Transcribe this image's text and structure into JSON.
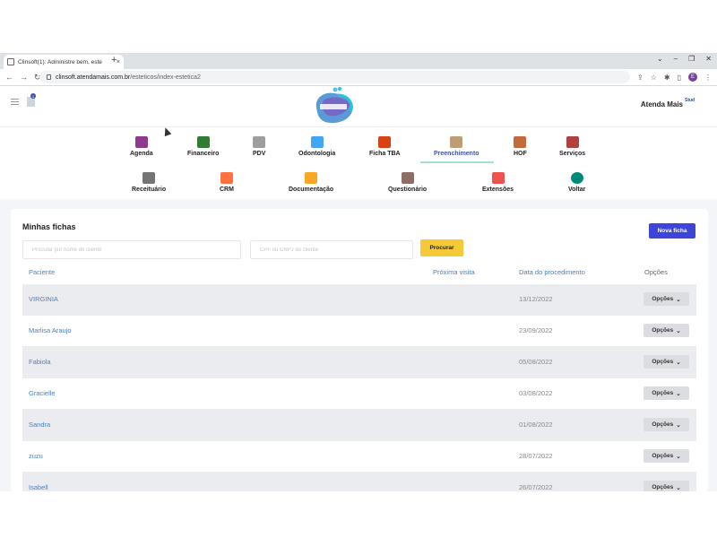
{
  "browser": {
    "tab_title": "Clinsoft(1): Administre bem, este",
    "tab_close": "×",
    "new_tab": "+",
    "url_host": "clinsoft.atendamais.com.br",
    "url_path": "/esteticos/index-estetica2",
    "profile_initial": "E"
  },
  "header": {
    "notification_count": "1",
    "user_name": "Atenda Mais",
    "user_badge": "Stud"
  },
  "modules_row1": [
    {
      "label": "Agenda",
      "color": "#8e3a8e"
    },
    {
      "label": "Financeiro",
      "color": "#2e7d32"
    },
    {
      "label": "PDV",
      "color": "#9e9e9e"
    },
    {
      "label": "Odontologia",
      "color": "#42a5f5"
    },
    {
      "label": "Ficha TBA",
      "color": "#d84315"
    },
    {
      "label": "Preenchimento",
      "color": "#bf9d74"
    },
    {
      "label": "HOF",
      "color": "#c46a3a"
    },
    {
      "label": "Serviços",
      "color": "#b0413e"
    }
  ],
  "modules_row2": [
    {
      "label": "Receituário",
      "color": "#757575"
    },
    {
      "label": "CRM",
      "color": "#ff7043"
    },
    {
      "label": "Documentação",
      "color": "#f9a825"
    },
    {
      "label": "Questionário",
      "color": "#8d6e63"
    },
    {
      "label": "Extensões",
      "color": "#ef5350"
    },
    {
      "label": "Voltar",
      "color": "#00897b"
    }
  ],
  "active_module": "Preenchimento",
  "main": {
    "title": "Minhas fichas",
    "new_button": "Nova ficha",
    "search_name_placeholder": "Procurar por nome do cliente",
    "search_cpf_placeholder": "CPF ou CNPJ do cliente",
    "search_button": "Procurar",
    "columns": {
      "patient": "Paciente",
      "next_visit": "Próxima visita",
      "procedure_date": "Data do procedimento",
      "options": "Opções"
    },
    "rows": [
      {
        "patient": "VIRGINIA",
        "next_visit": "",
        "date": "13/12/2022",
        "options": "Opções"
      },
      {
        "patient": "Marlisa Araujo",
        "next_visit": "",
        "date": "23/09/2022",
        "options": "Opções"
      },
      {
        "patient": "Fabiola",
        "next_visit": "",
        "date": "05/08/2022",
        "options": "Opções"
      },
      {
        "patient": "Gracielle",
        "next_visit": "",
        "date": "03/08/2022",
        "options": "Opções"
      },
      {
        "patient": "Sandra",
        "next_visit": "",
        "date": "01/08/2022",
        "options": "Opções"
      },
      {
        "patient": "zuzu",
        "next_visit": "",
        "date": "28/07/2022",
        "options": "Opções"
      },
      {
        "patient": "Isabell",
        "next_visit": "",
        "date": "26/07/2022",
        "options": "Opções"
      }
    ]
  }
}
